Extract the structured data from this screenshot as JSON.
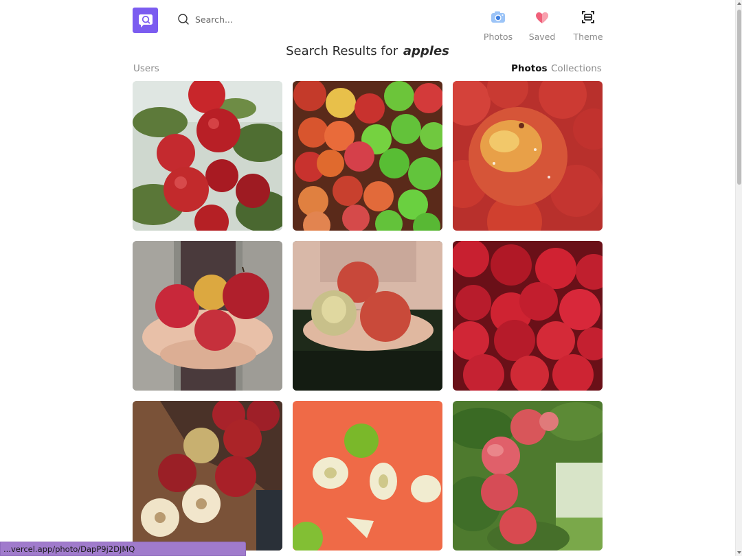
{
  "header": {
    "search_placeholder": "Search...",
    "nav": [
      {
        "label": "Photos",
        "icon": "camera-icon"
      },
      {
        "label": "Saved",
        "icon": "heart-icon"
      },
      {
        "label": "Theme",
        "icon": "theme-toggle-icon"
      }
    ]
  },
  "results": {
    "prefix": "Search Results for",
    "query": "apples"
  },
  "tabs": {
    "users": "Users",
    "photos": "Photos",
    "collections": "Collections",
    "active": "Photos"
  },
  "photos": [
    {
      "subject": "red apples on a tree branch"
    },
    {
      "subject": "pile of red and green apples"
    },
    {
      "subject": "close-up of wet red apples"
    },
    {
      "subject": "hands holding red apples"
    },
    {
      "subject": "hands holding apples in orchard"
    },
    {
      "subject": "heap of red apples"
    },
    {
      "subject": "apples on wooden table with cut halves"
    },
    {
      "subject": "green apples and slices on orange background"
    },
    {
      "subject": "apples hanging in orchard tree"
    }
  ],
  "status_url": "...vercel.app/photo/DapP9j2DJMQ",
  "colors": {
    "brand": "#7b5cf0",
    "status_bar": "#a07bcc",
    "camera_icon": "#5b9bf0",
    "heart_icon": "#f0607a"
  }
}
